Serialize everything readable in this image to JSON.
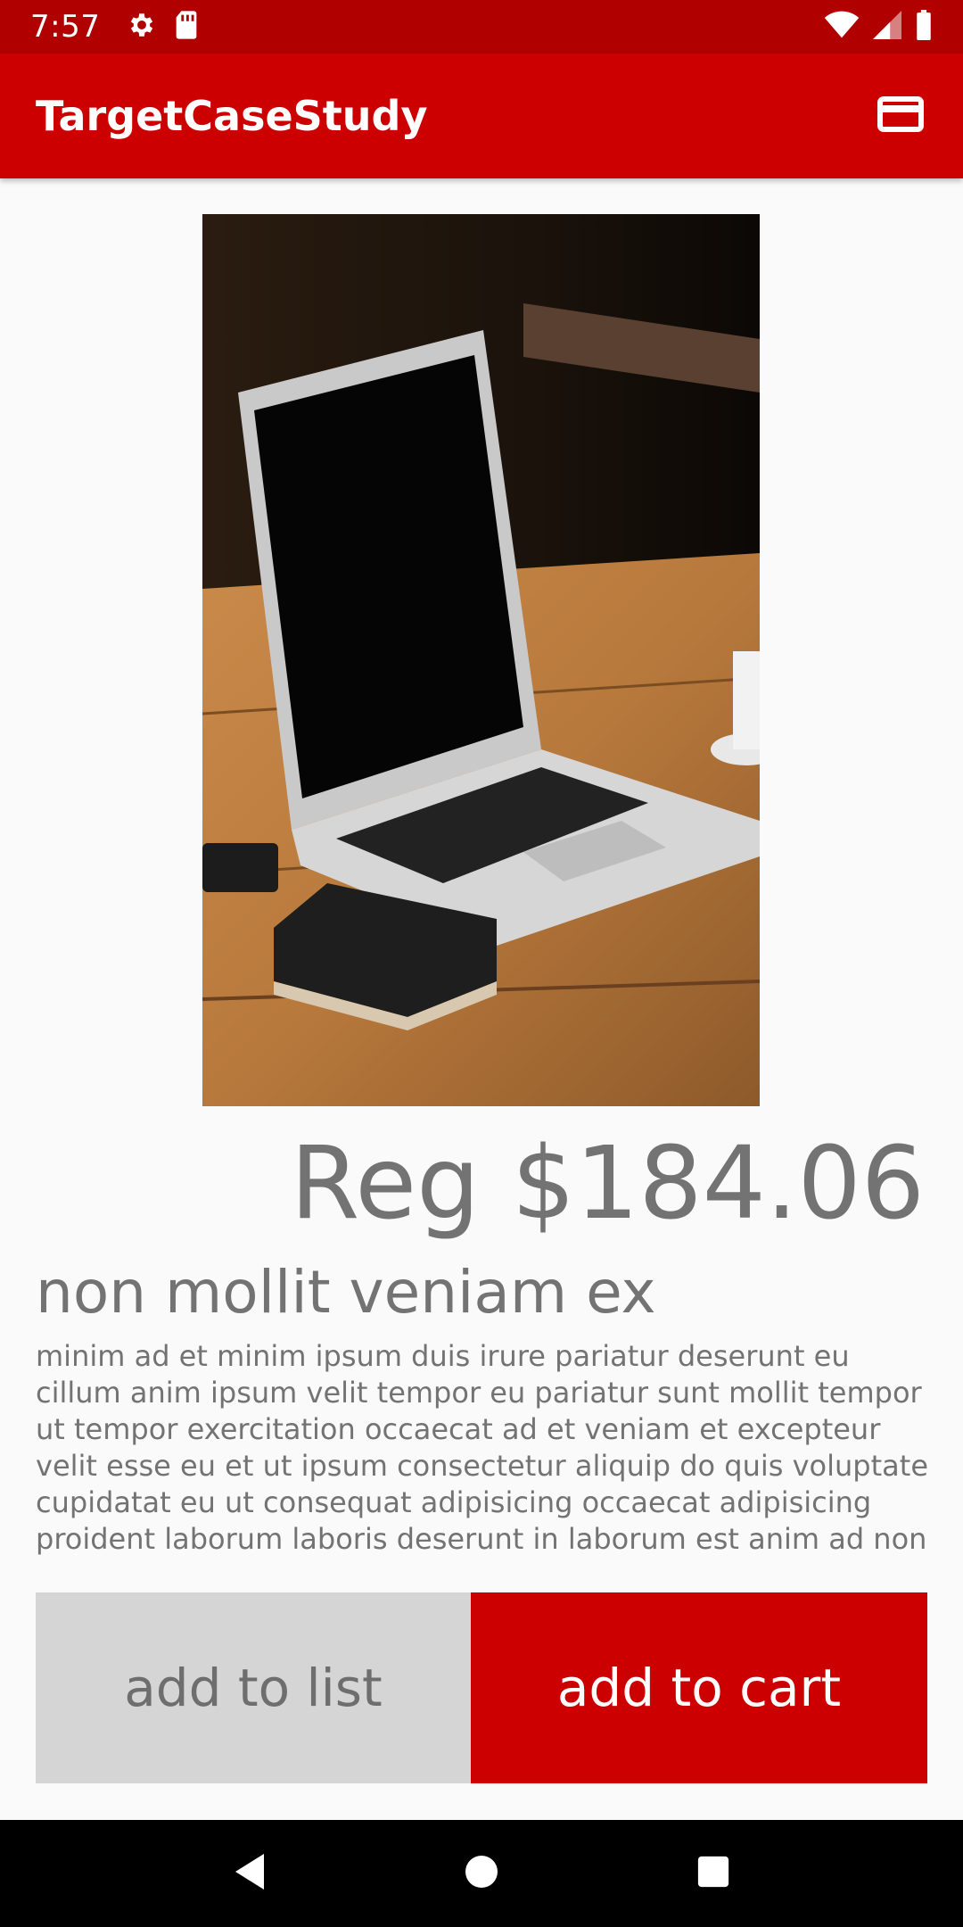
{
  "status_bar": {
    "time": "7:57",
    "icons_left": [
      "settings-icon",
      "sd-card-icon"
    ],
    "icons_right": [
      "wifi-icon",
      "cell-signal-icon",
      "battery-icon"
    ]
  },
  "app_bar": {
    "title": "TargetCaseStudy",
    "action_icon": "credit-card-icon"
  },
  "product": {
    "image_subject": "laptop on wooden table",
    "price": "Reg $184.06",
    "title": "non mollit veniam ex",
    "description": "minim ad et minim ipsum duis irure pariatur deserunt eu cillum anim ipsum velit tempor eu pariatur sunt mollit tempor ut tempor exercitation occaecat ad et veniam et excepteur velit esse eu et ut ipsum consectetur aliquip do quis voluptate cupidatat eu ut consequat adipisicing occaecat adipisicing proident laborum laboris deserunt in laborum est anim ad non"
  },
  "actions": {
    "add_to_list": "add to list",
    "add_to_cart": "add to cart"
  },
  "nav_bar": {
    "buttons": [
      "back-icon",
      "home-icon",
      "recents-icon"
    ]
  },
  "colors": {
    "primary": "#cc0000",
    "status_bar": "#b00000",
    "secondary_button": "#d5d5d5",
    "text_gray": "#737373"
  }
}
